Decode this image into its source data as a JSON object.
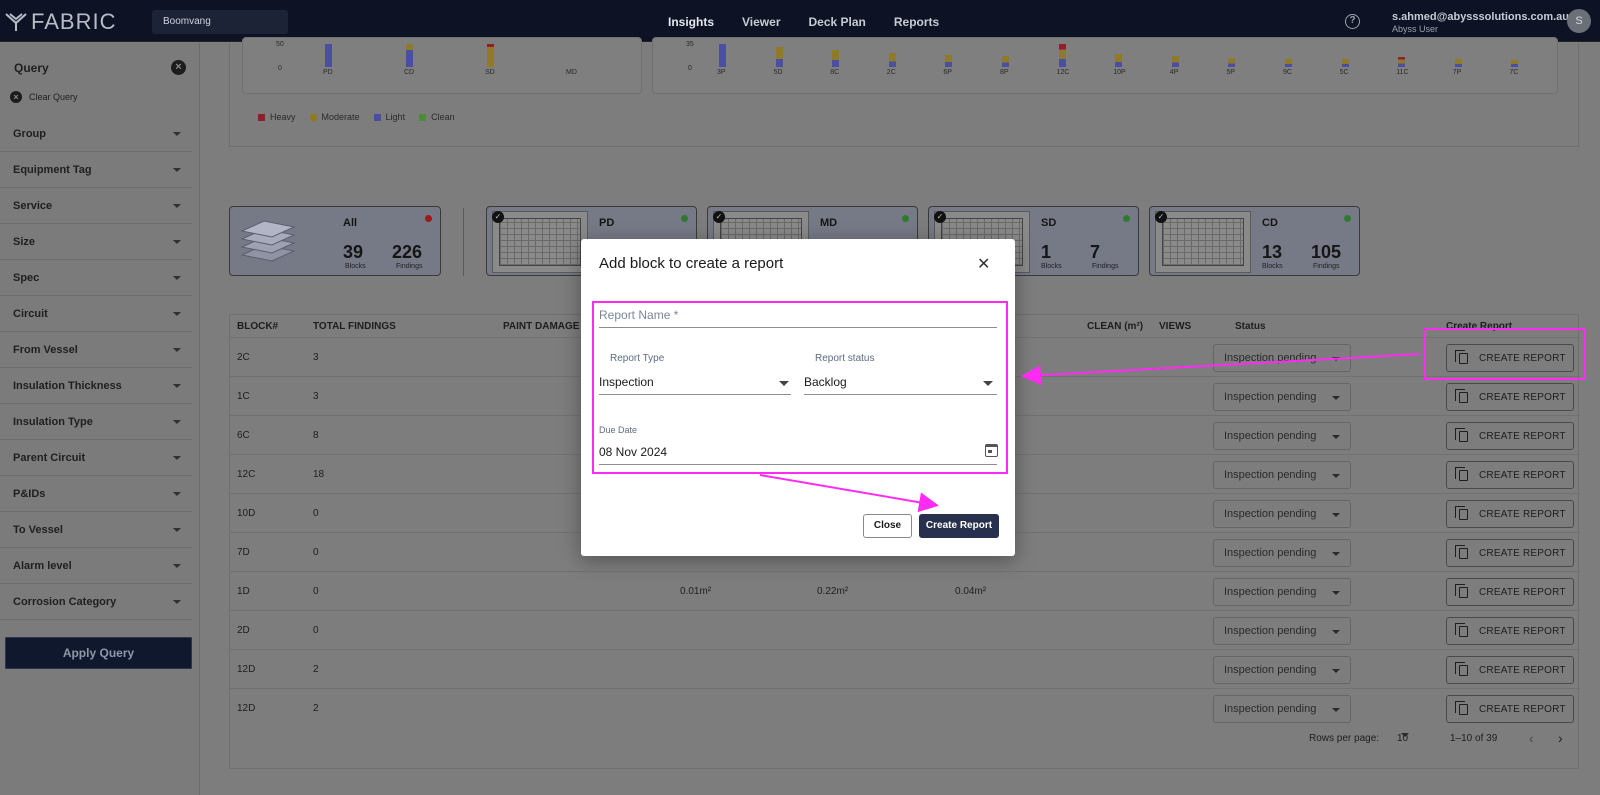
{
  "app": {
    "logo_text": "FABRIC",
    "search_value": "Boomvang",
    "nav": [
      "Insights",
      "Viewer",
      "Deck Plan",
      "Reports"
    ],
    "active_nav": "Insights",
    "user_email": "s.ahmed@abysssolutions.com.au",
    "user_role": "Abyss User",
    "avatar_initial": "S",
    "help_glyph": "?"
  },
  "sidebar": {
    "title": "Query",
    "clear_label": "Clear Query",
    "filters": [
      "Group",
      "Equipment Tag",
      "Service",
      "Size",
      "Spec",
      "Circuit",
      "From Vessel",
      "Insulation Thickness",
      "Insulation Type",
      "Parent Circuit",
      "P&IDs",
      "To Vessel",
      "Alarm level",
      "Corrosion Category"
    ],
    "apply_label": "Apply Query"
  },
  "charts": {
    "left_ticks": [
      "50",
      "0"
    ],
    "left_categories": [
      "PD",
      "CD",
      "SD",
      "MD"
    ],
    "right_ticks": [
      "35",
      "0"
    ],
    "right_categories": [
      "3P",
      "5D",
      "8C",
      "2C",
      "6P",
      "8P",
      "12C",
      "10P",
      "4P",
      "5P",
      "9C",
      "5C",
      "11C",
      "7P",
      "7C"
    ],
    "legend": [
      {
        "label": "Heavy",
        "color": "#8f1f2a"
      },
      {
        "label": "Moderate",
        "color": "#8f7a2a"
      },
      {
        "label": "Light",
        "color": "#4a4fa0"
      },
      {
        "label": "Clean",
        "color": "#4e8a3a"
      }
    ]
  },
  "blocks": {
    "blocks_label": "Blocks",
    "findings_label": "Findings",
    "check_glyph": "✓",
    "items": [
      {
        "name": "All",
        "blocks": "39",
        "findings": "226",
        "dot": "#a01818"
      },
      {
        "name": "PD",
        "blocks": "",
        "findings": "",
        "dot": "#2f7a2f"
      },
      {
        "name": "MD",
        "blocks": "",
        "findings": "",
        "dot": "#2f7a2f"
      },
      {
        "name": "SD",
        "blocks": "1",
        "findings": "7",
        "dot": "#2f7a2f"
      },
      {
        "name": "CD",
        "blocks": "13",
        "findings": "105",
        "dot": "#2f7a2f"
      }
    ]
  },
  "table": {
    "headers": {
      "block": "BLOCK#",
      "total": "TOTAL FINDINGS",
      "paint": "PAINT DAMAGE",
      "clean": "CLEAN (m²)",
      "views": "VIEWS",
      "status": "Status",
      "create": "Create Report"
    },
    "status_value": "Inspection pending",
    "create_label": "CREATE REPORT",
    "rows": [
      {
        "block": "2C",
        "total": "3",
        "c1": "",
        "c2": "",
        "c3": ""
      },
      {
        "block": "1C",
        "total": "3",
        "c1": "",
        "c2": "",
        "c3": ""
      },
      {
        "block": "6C",
        "total": "8",
        "c1": "",
        "c2": "",
        "c3": ""
      },
      {
        "block": "12C",
        "total": "18",
        "c1": "",
        "c2": "",
        "c3": ""
      },
      {
        "block": "10D",
        "total": "0",
        "c1": "",
        "c2": "",
        "c3": ""
      },
      {
        "block": "7D",
        "total": "0",
        "c1": "",
        "c2": "",
        "c3": ""
      },
      {
        "block": "1D",
        "total": "0",
        "c1": "0.01m²",
        "c2": "0.22m²",
        "c3": "0.04m²"
      },
      {
        "block": "2D",
        "total": "0",
        "c1": "",
        "c2": "",
        "c3": ""
      },
      {
        "block": "12D",
        "total": "2",
        "c1": "",
        "c2": "",
        "c3": ""
      },
      {
        "block": "12D",
        "total": "2",
        "c1": "",
        "c2": "",
        "c3": ""
      }
    ],
    "rows_per_page_label": "Rows per page:",
    "rows_per_page": "10",
    "range": "1–10 of 39"
  },
  "modal": {
    "title": "Add block to create a report",
    "close_glyph": "✕",
    "report_name_label": "Report Name *",
    "report_type_label": "Report Type",
    "report_type_value": "Inspection",
    "report_status_label": "Report status",
    "report_status_value": "Backlog",
    "due_date_label": "Due Date",
    "due_date_value": "08 Nov 2024",
    "close_button": "Close",
    "create_button": "Create Report"
  },
  "colors": {
    "highlight": "#ff2bf2",
    "primary_dark": "#27314e",
    "topbar": "#0d1324"
  }
}
